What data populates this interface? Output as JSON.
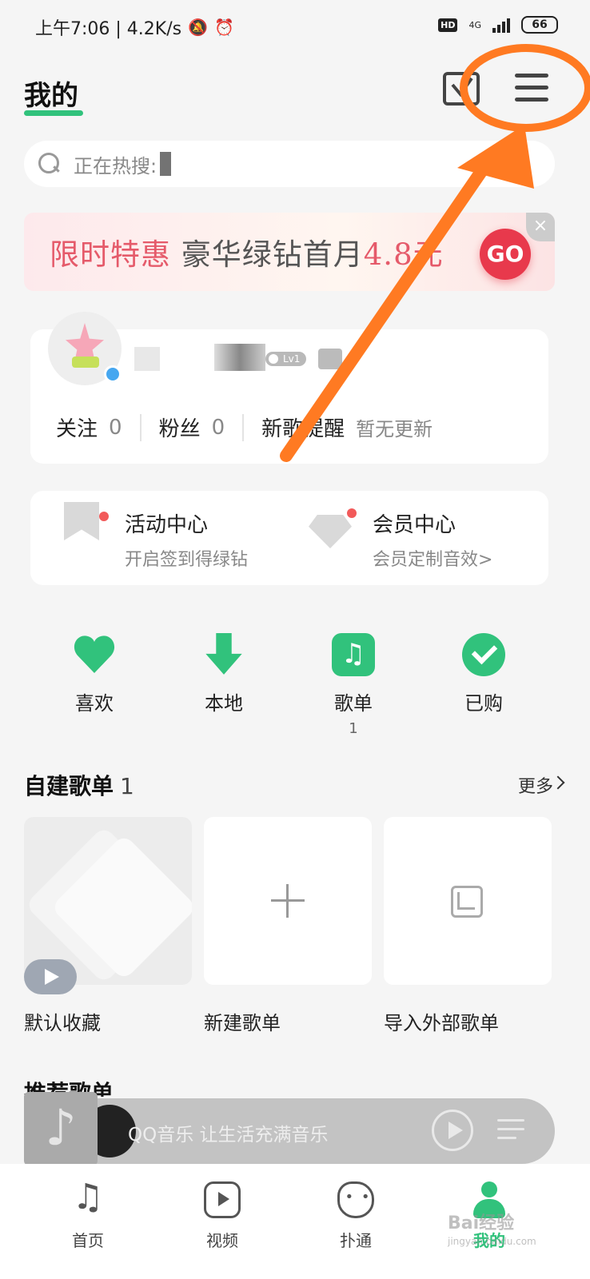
{
  "status_bar": {
    "left_text": "上午7:06 | 4.2K/s",
    "hd": "HD",
    "network": "4G",
    "battery": "66"
  },
  "header": {
    "title": "我的"
  },
  "search": {
    "placeholder": "正在热搜:"
  },
  "banner": {
    "text_red": "限时特惠",
    "text_dark": "豪华绿钻首月",
    "text_price": "4.8元",
    "go_label": "GO",
    "close": "×"
  },
  "profile": {
    "level": "Lv1",
    "stats": [
      {
        "label": "关注",
        "value": "0"
      },
      {
        "label": "粉丝",
        "value": "0"
      },
      {
        "label": "新歌提醒",
        "value": "暂无更新"
      }
    ]
  },
  "activity": {
    "items": [
      {
        "title": "活动中心",
        "sub": "开启签到得绿钻",
        "icon": "bookmark-icon"
      },
      {
        "title": "会员中心",
        "sub": "会员定制音效>",
        "icon": "diamond-icon"
      }
    ]
  },
  "shortcuts": [
    {
      "label": "喜欢",
      "count": "",
      "icon": "heart-icon"
    },
    {
      "label": "本地",
      "count": "",
      "icon": "download-icon"
    },
    {
      "label": "歌单",
      "count": "1",
      "icon": "playlist-icon"
    },
    {
      "label": "已购",
      "count": "",
      "icon": "check-icon"
    }
  ],
  "self_playlists": {
    "title": "自建歌单",
    "count": "1",
    "more": "更多",
    "items": [
      {
        "label": "默认收藏"
      },
      {
        "label": "新建歌单"
      },
      {
        "label": "导入外部歌单"
      }
    ]
  },
  "recommend": {
    "title": "推荐歌单"
  },
  "player": {
    "text": "QQ音乐 让生活充满音乐"
  },
  "bottom_nav": [
    {
      "label": "首页",
      "icon": "music-note-icon"
    },
    {
      "label": "视频",
      "icon": "video-icon"
    },
    {
      "label": "扑通",
      "icon": "face-icon"
    },
    {
      "label": "我的",
      "icon": "me-icon",
      "active": true
    }
  ],
  "watermark": {
    "main": "Bai经验",
    "sub": "jingyan.baidu.com"
  },
  "colors": {
    "accent": "#31c27c",
    "banner_red": "#e55a6a",
    "annotation": "#ff7a22"
  }
}
